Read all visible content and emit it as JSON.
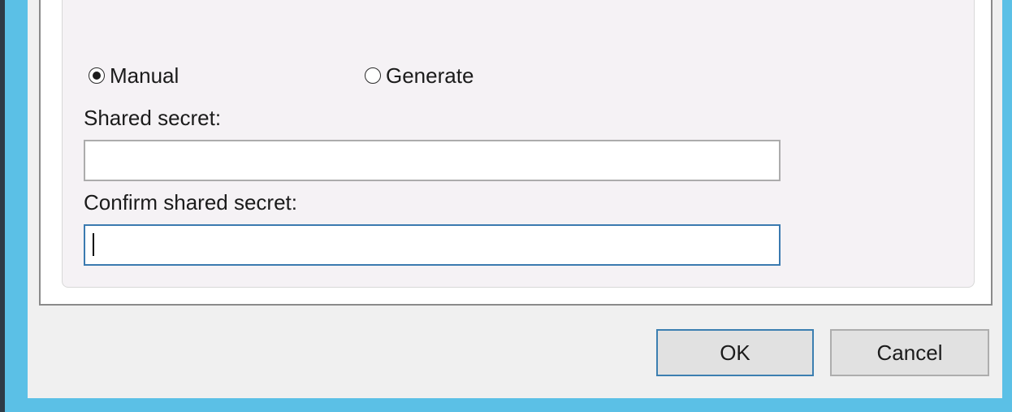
{
  "secret_mode": {
    "manual_label": "Manual",
    "generate_label": "Generate",
    "selected": "Manual"
  },
  "shared_secret": {
    "label": "Shared secret:",
    "value": ""
  },
  "confirm_shared_secret": {
    "label": "Confirm shared secret:",
    "value": ""
  },
  "buttons": {
    "ok_label": "OK",
    "cancel_label": "Cancel"
  },
  "colors": {
    "window_border": "#5bc0e6",
    "dialog_background": "#f0f0f0",
    "group_background": "#f5f2f5",
    "focus_border": "#3a7ab0"
  }
}
